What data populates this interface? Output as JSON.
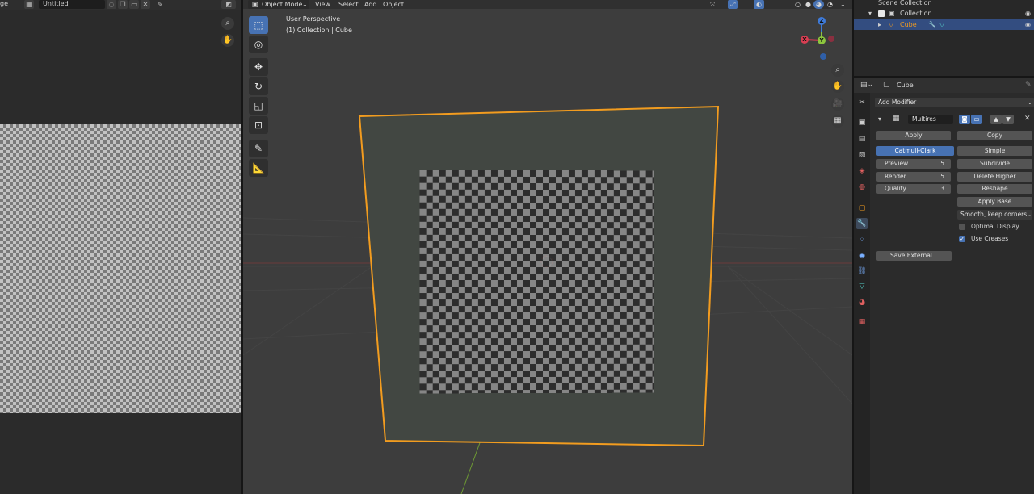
{
  "image_editor": {
    "header": {
      "partial_label": "ge",
      "image_name": "Untitled"
    }
  },
  "viewport": {
    "header": {
      "mode_label": "Object Mode",
      "menus": [
        "View",
        "Select",
        "Add",
        "Object"
      ]
    },
    "info": {
      "perspective": "User Perspective",
      "collection_line": "(1) Collection | Cube"
    },
    "gizmo": {
      "x_label": "X",
      "y_label": "Y",
      "z_label": "Z"
    },
    "colors": {
      "selection_outline": "#f29c1f",
      "y_axis": "#7fa63a",
      "x_axis": "#8a3b3b"
    }
  },
  "outliner": {
    "scene_collection": "Scene Collection",
    "collection": "Collection",
    "object": "Cube"
  },
  "properties": {
    "object_name": "Cube",
    "add_modifier": "Add Modifier",
    "modifier": {
      "name": "Multires",
      "apply": "Apply",
      "copy": "Copy",
      "catmull_clark": "Catmull-Clark",
      "simple": "Simple",
      "subdivide": "Subdivide",
      "delete_higher": "Delete Higher",
      "reshape": "Reshape",
      "apply_base": "Apply Base",
      "preview_label": "Preview",
      "preview_value": "5",
      "render_label": "Render",
      "render_value": "5",
      "quality_label": "Quality",
      "quality_value": "3",
      "uv_smooth": "Smooth, keep corners",
      "optimal_display": "Optimal Display",
      "use_creases": "Use Creases",
      "save_external": "Save External..."
    }
  }
}
